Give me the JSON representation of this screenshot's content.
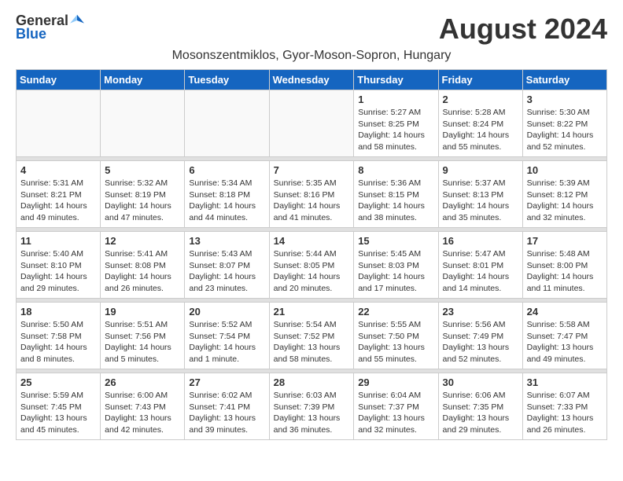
{
  "header": {
    "logo_general": "General",
    "logo_blue": "Blue",
    "month_title": "August 2024",
    "subtitle": "Mosonszentmiklos, Gyor-Moson-Sopron, Hungary"
  },
  "days_of_week": [
    "Sunday",
    "Monday",
    "Tuesday",
    "Wednesday",
    "Thursday",
    "Friday",
    "Saturday"
  ],
  "weeks": [
    [
      {
        "day": "",
        "info": ""
      },
      {
        "day": "",
        "info": ""
      },
      {
        "day": "",
        "info": ""
      },
      {
        "day": "",
        "info": ""
      },
      {
        "day": "1",
        "info": "Sunrise: 5:27 AM\nSunset: 8:25 PM\nDaylight: 14 hours\nand 58 minutes."
      },
      {
        "day": "2",
        "info": "Sunrise: 5:28 AM\nSunset: 8:24 PM\nDaylight: 14 hours\nand 55 minutes."
      },
      {
        "day": "3",
        "info": "Sunrise: 5:30 AM\nSunset: 8:22 PM\nDaylight: 14 hours\nand 52 minutes."
      }
    ],
    [
      {
        "day": "4",
        "info": "Sunrise: 5:31 AM\nSunset: 8:21 PM\nDaylight: 14 hours\nand 49 minutes."
      },
      {
        "day": "5",
        "info": "Sunrise: 5:32 AM\nSunset: 8:19 PM\nDaylight: 14 hours\nand 47 minutes."
      },
      {
        "day": "6",
        "info": "Sunrise: 5:34 AM\nSunset: 8:18 PM\nDaylight: 14 hours\nand 44 minutes."
      },
      {
        "day": "7",
        "info": "Sunrise: 5:35 AM\nSunset: 8:16 PM\nDaylight: 14 hours\nand 41 minutes."
      },
      {
        "day": "8",
        "info": "Sunrise: 5:36 AM\nSunset: 8:15 PM\nDaylight: 14 hours\nand 38 minutes."
      },
      {
        "day": "9",
        "info": "Sunrise: 5:37 AM\nSunset: 8:13 PM\nDaylight: 14 hours\nand 35 minutes."
      },
      {
        "day": "10",
        "info": "Sunrise: 5:39 AM\nSunset: 8:12 PM\nDaylight: 14 hours\nand 32 minutes."
      }
    ],
    [
      {
        "day": "11",
        "info": "Sunrise: 5:40 AM\nSunset: 8:10 PM\nDaylight: 14 hours\nand 29 minutes."
      },
      {
        "day": "12",
        "info": "Sunrise: 5:41 AM\nSunset: 8:08 PM\nDaylight: 14 hours\nand 26 minutes."
      },
      {
        "day": "13",
        "info": "Sunrise: 5:43 AM\nSunset: 8:07 PM\nDaylight: 14 hours\nand 23 minutes."
      },
      {
        "day": "14",
        "info": "Sunrise: 5:44 AM\nSunset: 8:05 PM\nDaylight: 14 hours\nand 20 minutes."
      },
      {
        "day": "15",
        "info": "Sunrise: 5:45 AM\nSunset: 8:03 PM\nDaylight: 14 hours\nand 17 minutes."
      },
      {
        "day": "16",
        "info": "Sunrise: 5:47 AM\nSunset: 8:01 PM\nDaylight: 14 hours\nand 14 minutes."
      },
      {
        "day": "17",
        "info": "Sunrise: 5:48 AM\nSunset: 8:00 PM\nDaylight: 14 hours\nand 11 minutes."
      }
    ],
    [
      {
        "day": "18",
        "info": "Sunrise: 5:50 AM\nSunset: 7:58 PM\nDaylight: 14 hours\nand 8 minutes."
      },
      {
        "day": "19",
        "info": "Sunrise: 5:51 AM\nSunset: 7:56 PM\nDaylight: 14 hours\nand 5 minutes."
      },
      {
        "day": "20",
        "info": "Sunrise: 5:52 AM\nSunset: 7:54 PM\nDaylight: 14 hours\nand 1 minute."
      },
      {
        "day": "21",
        "info": "Sunrise: 5:54 AM\nSunset: 7:52 PM\nDaylight: 13 hours\nand 58 minutes."
      },
      {
        "day": "22",
        "info": "Sunrise: 5:55 AM\nSunset: 7:50 PM\nDaylight: 13 hours\nand 55 minutes."
      },
      {
        "day": "23",
        "info": "Sunrise: 5:56 AM\nSunset: 7:49 PM\nDaylight: 13 hours\nand 52 minutes."
      },
      {
        "day": "24",
        "info": "Sunrise: 5:58 AM\nSunset: 7:47 PM\nDaylight: 13 hours\nand 49 minutes."
      }
    ],
    [
      {
        "day": "25",
        "info": "Sunrise: 5:59 AM\nSunset: 7:45 PM\nDaylight: 13 hours\nand 45 minutes."
      },
      {
        "day": "26",
        "info": "Sunrise: 6:00 AM\nSunset: 7:43 PM\nDaylight: 13 hours\nand 42 minutes."
      },
      {
        "day": "27",
        "info": "Sunrise: 6:02 AM\nSunset: 7:41 PM\nDaylight: 13 hours\nand 39 minutes."
      },
      {
        "day": "28",
        "info": "Sunrise: 6:03 AM\nSunset: 7:39 PM\nDaylight: 13 hours\nand 36 minutes."
      },
      {
        "day": "29",
        "info": "Sunrise: 6:04 AM\nSunset: 7:37 PM\nDaylight: 13 hours\nand 32 minutes."
      },
      {
        "day": "30",
        "info": "Sunrise: 6:06 AM\nSunset: 7:35 PM\nDaylight: 13 hours\nand 29 minutes."
      },
      {
        "day": "31",
        "info": "Sunrise: 6:07 AM\nSunset: 7:33 PM\nDaylight: 13 hours\nand 26 minutes."
      }
    ]
  ]
}
